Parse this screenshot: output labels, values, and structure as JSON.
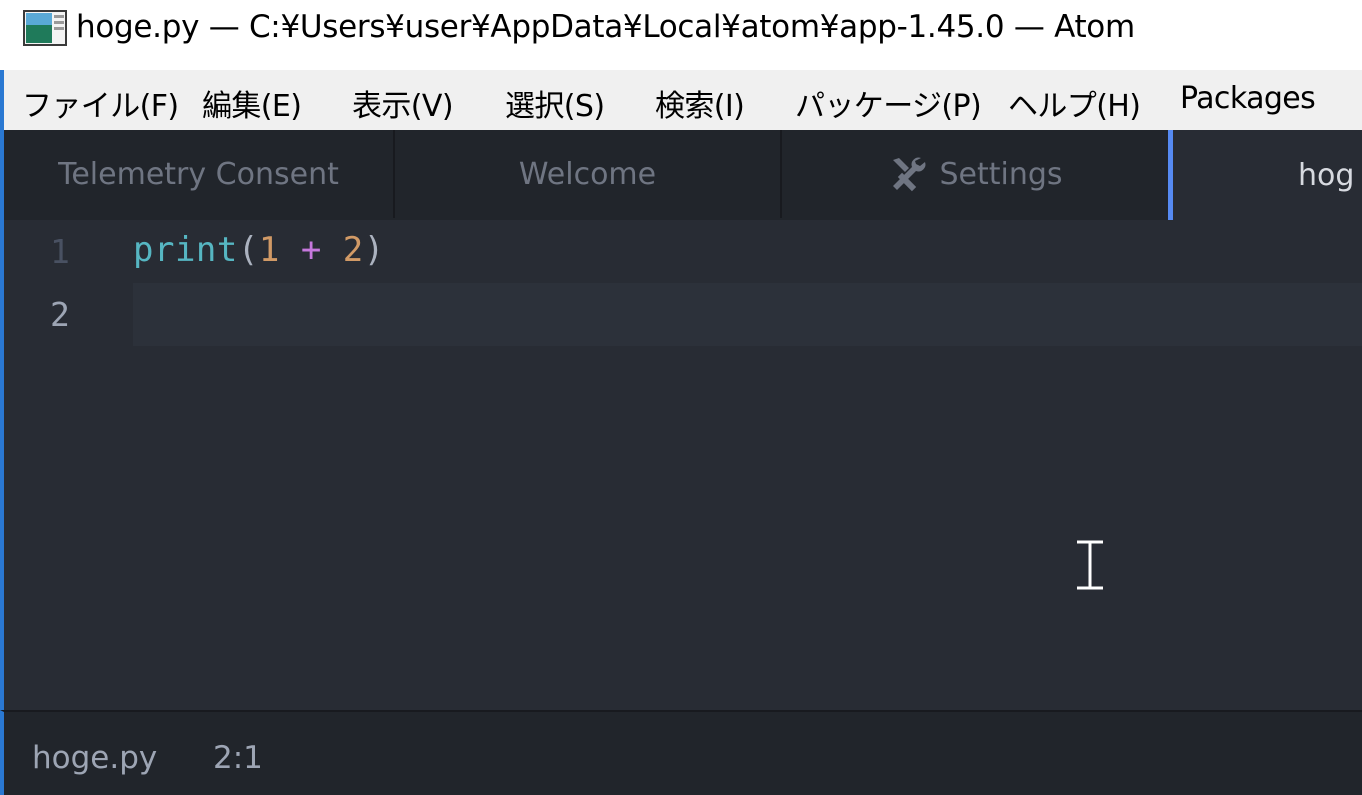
{
  "window": {
    "title": "hoge.py — C:¥Users¥user¥AppData¥Local¥atom¥app-1.45.0 — Atom"
  },
  "menu": [
    {
      "label": "ファイル(F)"
    },
    {
      "label": "編集(E)"
    },
    {
      "label": "表示(V)"
    },
    {
      "label": "選択(S)"
    },
    {
      "label": "検索(I)"
    },
    {
      "label": "パッケージ(P)"
    },
    {
      "label": "ヘルプ(H)"
    },
    {
      "label": "Packages"
    }
  ],
  "tabs": [
    {
      "label": "Telemetry Consent",
      "active": false
    },
    {
      "label": "Welcome",
      "active": false
    },
    {
      "label": "Settings",
      "icon": "tools-icon",
      "active": false
    },
    {
      "label": "hog",
      "active": true
    }
  ],
  "editor": {
    "line_numbers": [
      "1",
      "2"
    ],
    "lines": [
      {
        "tokens": [
          {
            "text": "print",
            "type": "function"
          },
          {
            "text": "(",
            "type": "paren"
          },
          {
            "text": "1",
            "type": "number"
          },
          {
            "text": " ",
            "type": "space"
          },
          {
            "text": "+",
            "type": "operator"
          },
          {
            "text": " ",
            "type": "space"
          },
          {
            "text": "2",
            "type": "number"
          },
          {
            "text": ")",
            "type": "paren"
          }
        ]
      },
      {
        "tokens": []
      }
    ],
    "current_line": 2
  },
  "statusbar": {
    "filename": "hoge.py",
    "cursor_position": "2:1"
  },
  "colors": {
    "accent": "#568af2",
    "editor_bg": "#282c34",
    "chrome_bg": "#21252b",
    "function": "#56b6c2",
    "number": "#d19a66",
    "operator": "#c678dd"
  }
}
